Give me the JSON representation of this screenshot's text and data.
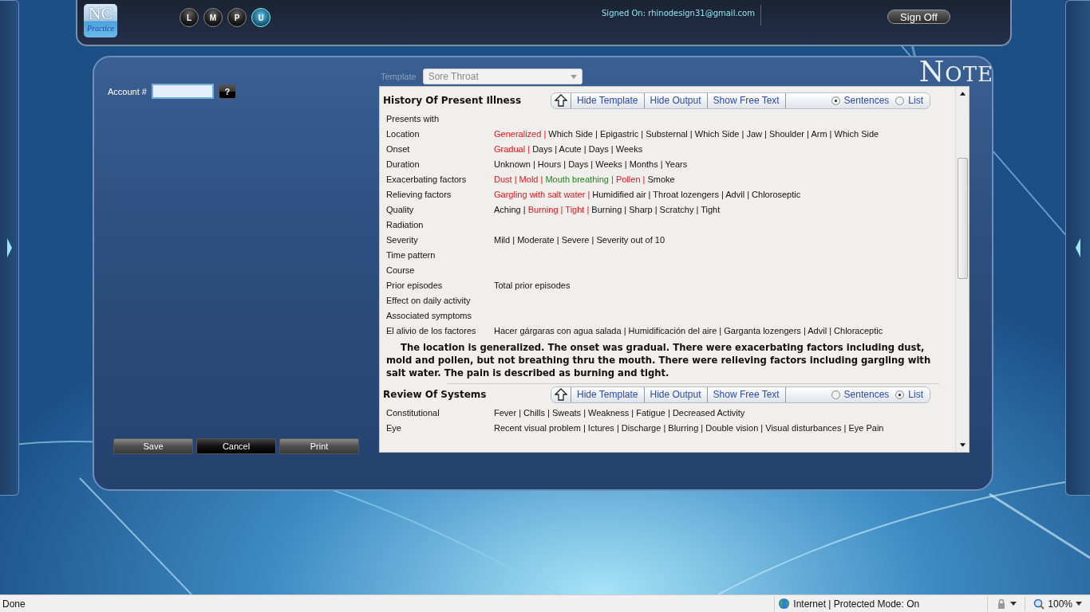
{
  "header": {
    "logo_top": "NC",
    "logo_bottom": "Practice",
    "modules": [
      {
        "label": "L",
        "selected": false
      },
      {
        "label": "M",
        "selected": false
      },
      {
        "label": "P",
        "selected": false
      },
      {
        "label": "U",
        "selected": true
      }
    ],
    "signed_on": "Signed On: rhinodesign31@gmail.com",
    "sign_off": "Sign Off"
  },
  "page_title": "NOTE",
  "account": {
    "label": "Account #",
    "help": "?"
  },
  "buttons": [
    {
      "label": "Save",
      "kind": "normal"
    },
    {
      "label": "Cancel",
      "kind": "primary"
    },
    {
      "label": "Print",
      "kind": "normal"
    }
  ],
  "template": {
    "label": "Template",
    "value": "Sore Throat",
    "disabled": true
  },
  "separator": "|",
  "sections": [
    {
      "title": "History Of Present Illness",
      "toolbar": [
        "Hide Template",
        "Hide Output",
        "Show Free Text"
      ],
      "modes": [
        {
          "label": "Sentences",
          "selected": true
        },
        {
          "label": "List",
          "selected": false
        }
      ],
      "rows": [
        {
          "label": "Presents with"
        },
        {
          "label": "Location",
          "options": [
            {
              "text": "Generalized",
              "selected": true,
              "negated": false
            },
            {
              "text": "Which Side",
              "selected": false,
              "negated": false
            },
            {
              "text": "Epigastric",
              "selected": false,
              "negated": false
            },
            {
              "text": "Substernal",
              "selected": false,
              "negated": false
            },
            {
              "text": "Which Side",
              "selected": false,
              "negated": false
            },
            {
              "text": "Jaw",
              "selected": false,
              "negated": false
            },
            {
              "text": "Shoulder",
              "selected": false,
              "negated": false
            },
            {
              "text": "Arm",
              "selected": false,
              "negated": false
            },
            {
              "text": "Which Side",
              "selected": false,
              "negated": false
            }
          ]
        },
        {
          "label": "Onset",
          "options": [
            {
              "text": "Gradual",
              "selected": true,
              "negated": false
            },
            {
              "text": "Days",
              "selected": false,
              "negated": false
            },
            {
              "text": "Acute",
              "selected": false,
              "negated": false
            },
            {
              "text": "Days",
              "selected": false,
              "negated": false
            },
            {
              "text": "Weeks",
              "selected": false,
              "negated": false
            }
          ]
        },
        {
          "label": "Duration",
          "options": [
            {
              "text": "Unknown",
              "selected": false,
              "negated": false
            },
            {
              "text": "Hours",
              "selected": false,
              "negated": false
            },
            {
              "text": "Days",
              "selected": false,
              "negated": false
            },
            {
              "text": "Weeks",
              "selected": false,
              "negated": false
            },
            {
              "text": "Months",
              "selected": false,
              "negated": false
            },
            {
              "text": "Years",
              "selected": false,
              "negated": false
            }
          ]
        },
        {
          "label": "Exacerbating factors",
          "options": [
            {
              "text": "Dust",
              "selected": true,
              "negated": false
            },
            {
              "text": "Mold",
              "selected": true,
              "negated": false
            },
            {
              "text": "Mouth breathing",
              "selected": true,
              "negated": true
            },
            {
              "text": "Pollen",
              "selected": true,
              "negated": false
            },
            {
              "text": "Smoke",
              "selected": false,
              "negated": false
            }
          ]
        },
        {
          "label": "Relieving factors",
          "options": [
            {
              "text": "Gargling with salt water",
              "selected": true,
              "negated": false
            },
            {
              "text": "Humidified air",
              "selected": false,
              "negated": false
            },
            {
              "text": "Throat lozengers",
              "selected": false,
              "negated": false
            },
            {
              "text": "Advil",
              "selected": false,
              "negated": false
            },
            {
              "text": "Chloroseptic",
              "selected": false,
              "negated": false
            }
          ]
        },
        {
          "label": "Quality",
          "options": [
            {
              "text": "Aching",
              "selected": false,
              "negated": false
            },
            {
              "text": "Burning",
              "selected": true,
              "negated": false
            },
            {
              "text": "Tight",
              "selected": true,
              "negated": false
            },
            {
              "text": "Burning",
              "selected": false,
              "negated": false
            },
            {
              "text": "Sharp",
              "selected": false,
              "negated": false
            },
            {
              "text": "Scratchy",
              "selected": false,
              "negated": false
            },
            {
              "text": "Tight",
              "selected": false,
              "negated": false
            }
          ]
        },
        {
          "label": "Radiation"
        },
        {
          "label": "Severity",
          "options": [
            {
              "text": "Mild",
              "selected": false,
              "negated": false
            },
            {
              "text": "Moderate",
              "selected": false,
              "negated": false
            },
            {
              "text": "Severe",
              "selected": false,
              "negated": false
            },
            {
              "text": "Severity out of 10",
              "selected": false,
              "negated": false
            }
          ]
        },
        {
          "label": "Time pattern"
        },
        {
          "label": "Course"
        },
        {
          "label": "Prior episodes",
          "options": [
            {
              "text": "Total prior episodes",
              "selected": false,
              "negated": false
            }
          ]
        },
        {
          "label": "Effect on daily activity"
        },
        {
          "label": "Associated symptoms"
        },
        {
          "label": "El alivio de los factores",
          "options": [
            {
              "text": "Hacer gárgaras con agua salada",
              "selected": false,
              "negated": false
            },
            {
              "text": "Humidificación del aire",
              "selected": false,
              "negated": false
            },
            {
              "text": "Garganta lozengers",
              "selected": false,
              "negated": false
            },
            {
              "text": "Advil",
              "selected": false,
              "negated": false
            },
            {
              "text": "Chloraceptic",
              "selected": false,
              "negated": false
            }
          ]
        }
      ],
      "output": "The location is generalized.  The onset was gradual.  There were exacerbating factors including dust, mold and pollen, but not breathing thru the mouth.  There were relieving factors including gargling with salt water.  The pain is described as burning and tight."
    },
    {
      "title": "Review Of Systems",
      "toolbar": [
        "Hide Template",
        "Hide Output",
        "Show Free Text"
      ],
      "modes": [
        {
          "label": "Sentences",
          "selected": false
        },
        {
          "label": "List",
          "selected": true
        }
      ],
      "rows": [
        {
          "label": "Constitutional",
          "options": [
            {
              "text": "Fever",
              "selected": false,
              "negated": false
            },
            {
              "text": "Chills",
              "selected": false,
              "negated": false
            },
            {
              "text": "Sweats",
              "selected": false,
              "negated": false
            },
            {
              "text": "Weakness",
              "selected": false,
              "negated": false
            },
            {
              "text": "Fatigue",
              "selected": false,
              "negated": false
            },
            {
              "text": "Decreased Activity",
              "selected": false,
              "negated": false
            }
          ]
        },
        {
          "label": "Eye",
          "options": [
            {
              "text": "Recent visual problem",
              "selected": false,
              "negated": false
            },
            {
              "text": "Ictures",
              "selected": false,
              "negated": false
            },
            {
              "text": "Discharge",
              "selected": false,
              "negated": false
            },
            {
              "text": "Blurring",
              "selected": false,
              "negated": false
            },
            {
              "text": "Double vision",
              "selected": false,
              "negated": false
            },
            {
              "text": "Visual disturbances",
              "selected": false,
              "negated": false
            },
            {
              "text": "Eye Pain",
              "selected": false,
              "negated": false
            }
          ]
        }
      ]
    }
  ],
  "status_bar": {
    "text": "Done",
    "zone": "Internet | Protected Mode: On",
    "zoom": "100%"
  }
}
